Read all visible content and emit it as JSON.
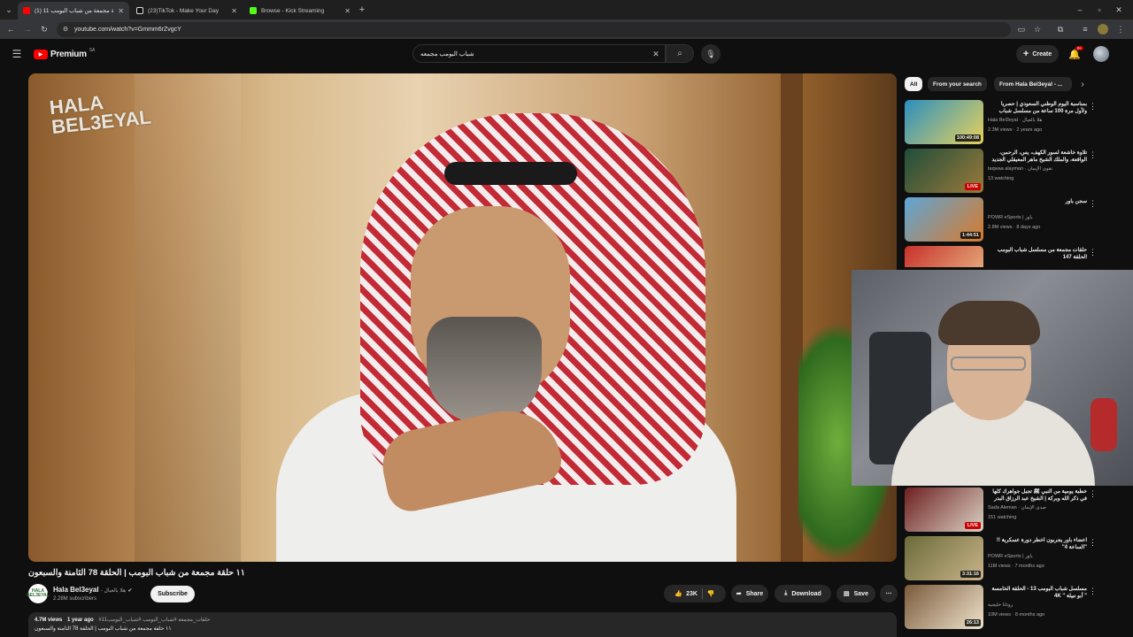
{
  "browser": {
    "tabs": [
      {
        "label": "(1) 11 حلقة مجمعة من شباب البومب",
        "favicon_color": "#ff0000",
        "active": true
      },
      {
        "label": "(23)TikTok - Make Your Day",
        "favicon_color": "#ffffff",
        "active": false
      },
      {
        "label": "Browse - Kick Streaming",
        "favicon_color": "#53fc18",
        "active": false
      }
    ],
    "url": "youtube.com/watch?v=Gmmm6rZvgcY"
  },
  "youtube": {
    "logo_text": "Premium",
    "region": "SA",
    "search_value": "شباب البومب مجمعه",
    "create_label": "Create",
    "notification_count": "9+"
  },
  "video": {
    "overlay_logo": "HALA BEL3EYAL",
    "title": "١١ حلقة مجمعة من شباب البومب | الحلقة 78 الثامنة والسبعون",
    "channel_avatar_text": "HALA BEL3EYAL",
    "channel_name": "Hala Bel3eyal",
    "channel_name_ar": "هلا بالعيال",
    "subscribers": "2.28M subscribers",
    "subscribe_label": "Subscribe",
    "likes": "23K",
    "share_label": "Share",
    "download_label": "Download",
    "save_label": "Save",
    "views": "4.7M views",
    "age": "1 year ago",
    "hashtags": "#حلقات_مجمعة #شباب_البومب #شباب_البومب11",
    "description_line": "١١ حلقة مجمعة من شباب البومب | الحلقة 78 الثامنة والسبعون"
  },
  "chips": [
    "All",
    "From your search",
    "From Hala Bel3eyal - ..."
  ],
  "recommendations": [
    {
      "title": "بمناسبة اليوم الوطني السعودي | حصرياً ولأول مرة 100 ساعة من مسلسل شباب",
      "channel": "Hala Bel3eyal · هلا بالعيال",
      "stats": "2.3M views · 2 years ago",
      "badge": "100:49:08",
      "badge_type": "duration",
      "thumb_colors": [
        "#2b8fbf",
        "#e8d25a"
      ]
    },
    {
      "title": "تلاوة خاشعة لسور الكهف، يس، الرحمن، الواقعة، والملك الشيخ ماهر المعيقلي الجديد",
      "channel": "taqwaa alayman · تقوى الإيمان",
      "stats": "13 watching",
      "badge": "LIVE",
      "badge_type": "live",
      "thumb_colors": [
        "#1f4d3a",
        "#9a7a3a"
      ]
    },
    {
      "title": "سجن باور",
      "channel": "POWR eSports | باور",
      "stats": "2.8M views · 8 days ago",
      "badge": "1:44:51",
      "badge_type": "duration",
      "thumb_colors": [
        "#5ea6d6",
        "#d87a2a"
      ]
    },
    {
      "title": "حلقات مجمعة من مسلسل شباب البومب الحلقة 147",
      "channel": "",
      "stats": "",
      "badge": "",
      "badge_type": "none",
      "thumb_colors": [
        "#c8302a",
        "#e9c08a"
      ]
    },
    {
      "title": "خطبة يومية من النبي ﷺ تجبل جواهرك كلها في ذكر الله وبركة | الشيخ عبد الرزاق البدر",
      "channel": "Sada Aleman · صدى الإيمان",
      "stats": "151 watching",
      "badge": "LIVE",
      "badge_type": "live",
      "thumb_colors": [
        "#6e1f1f",
        "#d9d1c4"
      ]
    },
    {
      "title": "اعضاء باور يجربون اخطر دورة عسكرية !! \"الساعة 4\"",
      "channel": "POWR eSports | باور",
      "stats": "11M views · 7 months ago",
      "badge": "3:31:16",
      "badge_type": "duration",
      "thumb_colors": [
        "#6b6b3a",
        "#c9b48a"
      ]
    },
    {
      "title": "مسلسل شباب البومب 13 - الحلقة الخامسة \" أبو نبيلة \" 4K",
      "channel": "روتانا خليجية",
      "stats": "10M views · 8 months ago",
      "badge": "26:13",
      "badge_type": "duration",
      "thumb_colors": [
        "#7a5a3a",
        "#efe3cc"
      ]
    }
  ]
}
